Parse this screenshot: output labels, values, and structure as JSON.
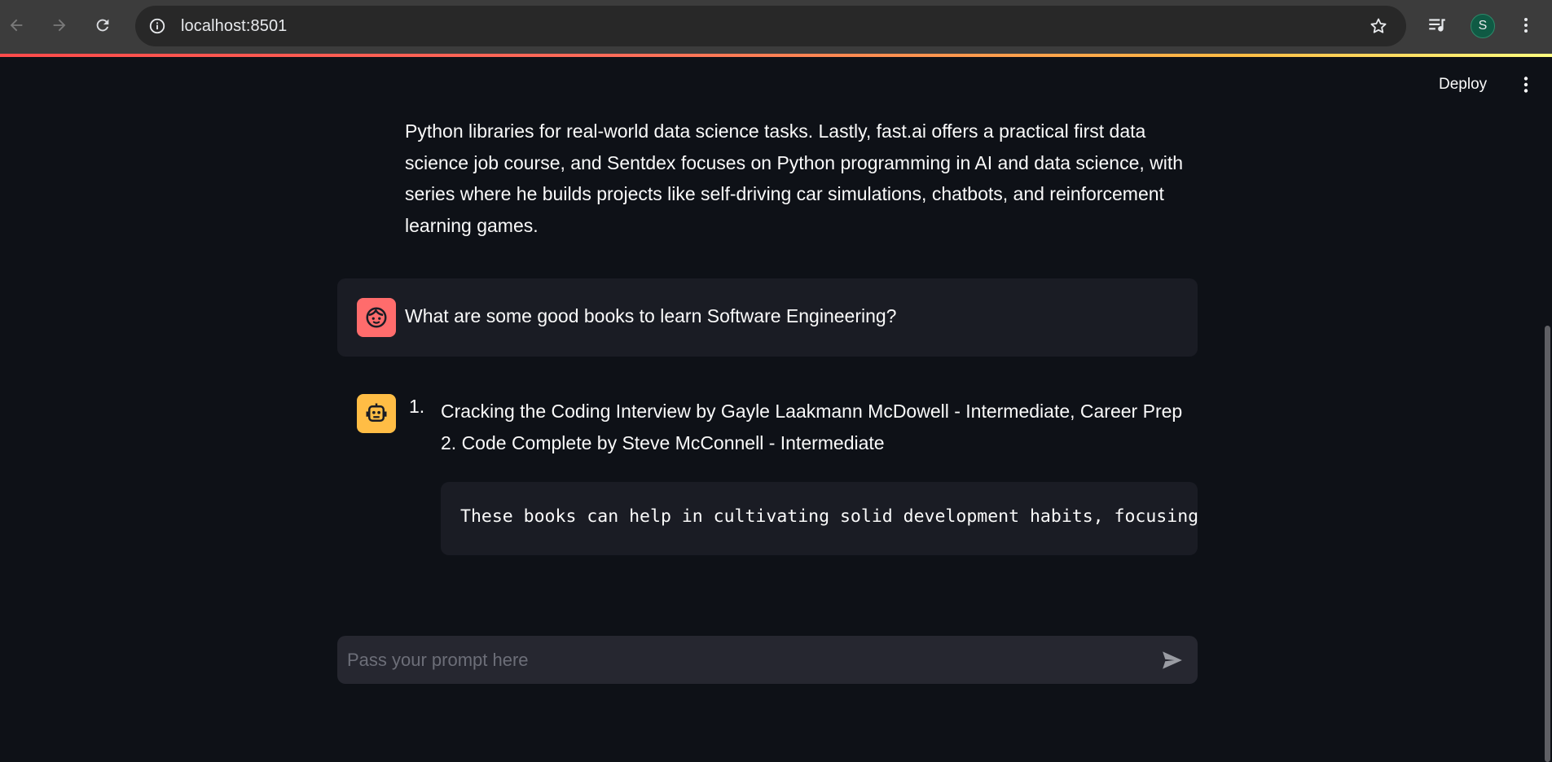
{
  "browser": {
    "url": "localhost:8501",
    "profile_initial": "S",
    "icons": {
      "back": "arrow-left-icon",
      "forward": "arrow-right-icon",
      "reload": "reload-icon",
      "site_info": "info-icon",
      "bookmark": "star-icon",
      "media": "media-playlist-icon",
      "menu": "vertical-dots-icon"
    }
  },
  "app_header": {
    "deploy_label": "Deploy",
    "menu_icon": "vertical-dots-icon"
  },
  "chat": {
    "previous_assistant_text": "Python libraries for real-world data science tasks. Lastly, fast.ai offers a practical first data science job course, and Sentdex focuses on Python programming in AI and data science, with series where he builds projects like self-driving car simulations, chatbots, and reinforcement learning games.",
    "user_message": "What are some good books to learn Software Engineering?",
    "user_avatar_icon": "smiley-face-icon",
    "assistant_avatar_icon": "robot-icon",
    "assistant_list_number": "1.",
    "assistant_list_text": "Cracking the Coding Interview by Gayle Laakmann McDowell - Intermediate, Career Prep 2. Code Complete by Steve McConnell - Intermediate",
    "assistant_code_text": "These books can help in cultivating solid development habits, focusing o"
  },
  "chat_input": {
    "placeholder": "Pass your prompt here",
    "value": "",
    "send_icon": "send-icon"
  },
  "colors": {
    "app_background": "#0e1117",
    "message_background": "#1a1c24",
    "input_background": "#262730",
    "user_avatar": "#ff6c6c",
    "assistant_avatar": "#ffbd45",
    "browser_bar": "#3c3c3c"
  }
}
